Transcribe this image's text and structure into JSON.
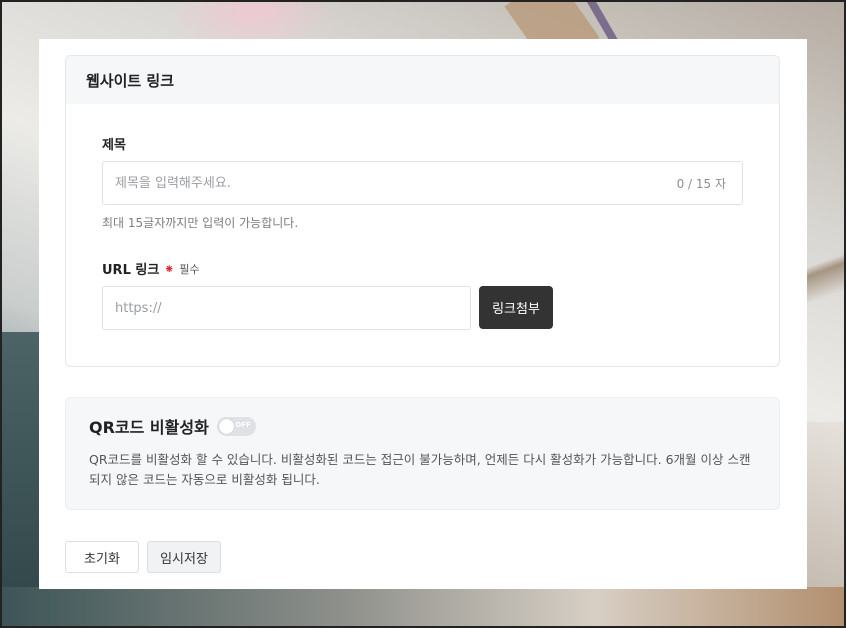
{
  "website_link": {
    "header": "웹사이트 링크",
    "title_label": "제목",
    "title_placeholder": "제목을 입력해주세요.",
    "title_counter": "0 / 15 자",
    "title_hint": "최대 15글자까지만 입력이 가능합니다.",
    "url_label": "URL 링크",
    "required_mark": "⁕",
    "required_text": "필수",
    "url_placeholder": "https://",
    "attach_button": "링크첨부"
  },
  "qr": {
    "title": "QR코드 비활성화",
    "toggle_state": "OFF",
    "description": "QR코드를 비활성화 할 수 있습니다. 비활성화된 코드는 접근이 불가능하며, 언제든 다시 활성화가 가능합니다. 6개월 이상 스캔되지 않은 코드는 자동으로 비활성화 됩니다."
  },
  "footer": {
    "reset_button": "초기화",
    "save_draft_button": "임시저장"
  },
  "colors": {
    "attach_button_bg": "#333333",
    "required": "#e0303a",
    "section_bg": "#f6f7f9"
  }
}
